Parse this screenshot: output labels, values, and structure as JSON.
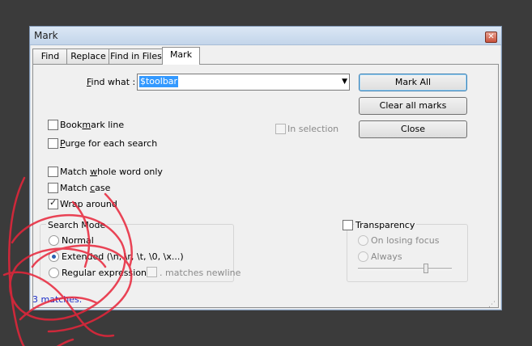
{
  "window": {
    "title": "Mark",
    "close_glyph": "✕"
  },
  "tabs": [
    {
      "label": "Find"
    },
    {
      "label": "Replace"
    },
    {
      "label": "Find in Files"
    },
    {
      "label": "Mark",
      "active": true
    }
  ],
  "find": {
    "label_prefix": "F",
    "label_rest": "ind what :",
    "value": "$toolbar",
    "dropdown_glyph": "▼"
  },
  "buttons": {
    "mark_all": "Mark All",
    "clear_all": "Clear all marks",
    "close": "Close"
  },
  "options": {
    "bookmark_line": {
      "pre": "Book",
      "ul": "m",
      "post": "ark line",
      "checked": false
    },
    "purge": {
      "pre": "",
      "ul": "P",
      "post": "urge for each search",
      "checked": false
    },
    "in_selection": {
      "label": "In selection",
      "checked": false,
      "disabled": true
    },
    "match_whole_word": {
      "pre": "Match ",
      "ul": "w",
      "post": "hole word only",
      "checked": false
    },
    "match_case": {
      "pre": "Match ",
      "ul": "c",
      "post": "ase",
      "checked": false
    },
    "wrap_around": {
      "label": "Wrap around",
      "checked": true
    }
  },
  "search_mode": {
    "title": "Search Mode",
    "normal": "Normal",
    "extended": "Extended (\\n, \\r, \\t, \\0, \\x...)",
    "regex": "Regular expression",
    "matches_newline": ". matches newline",
    "selected": "extended"
  },
  "transparency": {
    "label": "Transparency",
    "on_losing_focus": "On losing focus",
    "always": "Always",
    "level": 0.7
  },
  "status": {
    "text": "3 matches."
  },
  "colors": {
    "status_text": "#1e2ec8",
    "scribble": "#e8253a",
    "selection": "#3399ff"
  }
}
